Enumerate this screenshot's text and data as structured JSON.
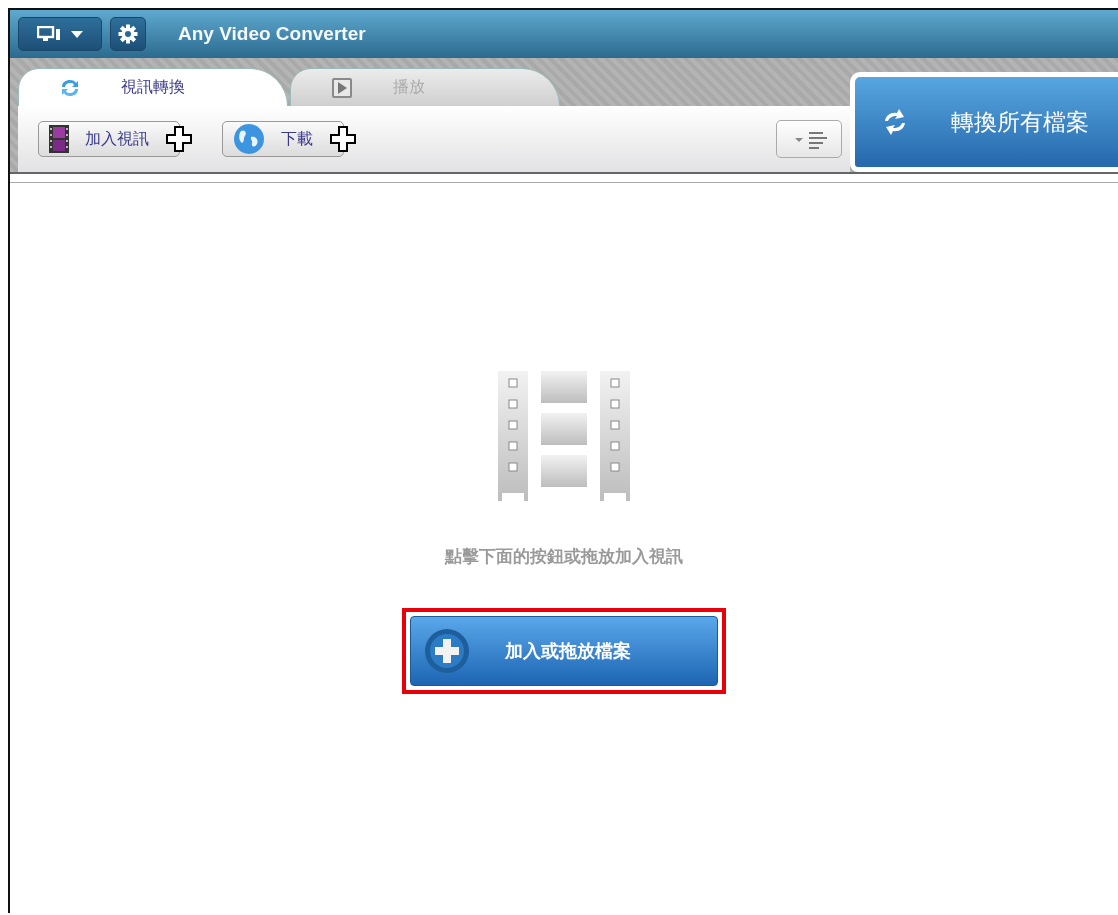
{
  "window": {
    "title": "Any Video Converter"
  },
  "tabs": [
    {
      "label": "視訊轉換",
      "selected": true,
      "kind": "convert"
    },
    {
      "label": "播放",
      "selected": false,
      "kind": "play"
    }
  ],
  "toolbar": {
    "buttons": [
      {
        "label": "加入視訊",
        "kind": "film"
      },
      {
        "label": "下載",
        "kind": "globe"
      }
    ]
  },
  "convert_all_button": {
    "label": "轉換所有檔案"
  },
  "empty_state": {
    "hint": "點擊下面的按鈕或拖放加入視訊",
    "add_button": {
      "label": "加入或拖放檔案",
      "highlighted": true
    }
  }
}
